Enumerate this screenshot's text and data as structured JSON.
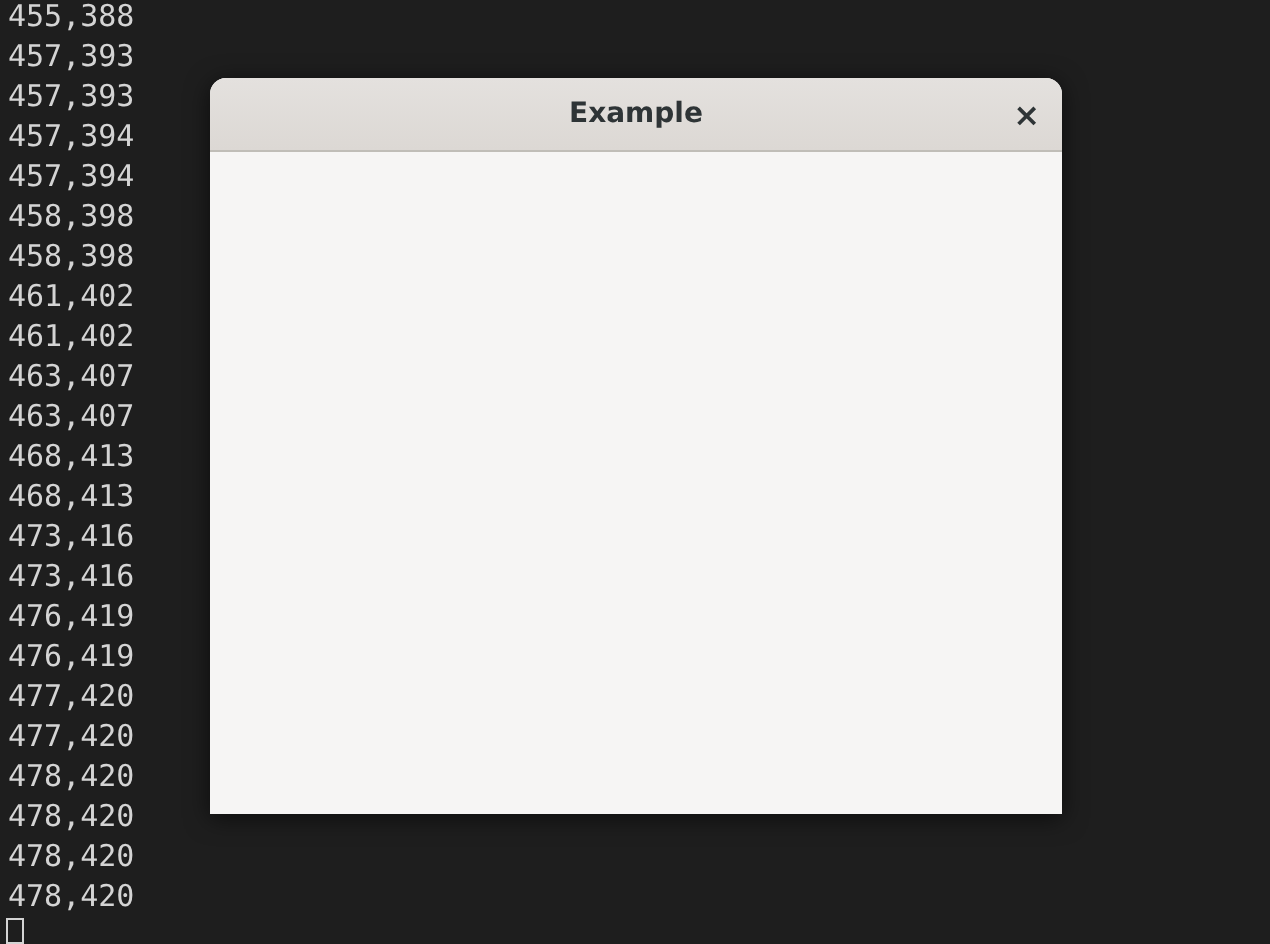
{
  "terminal": {
    "lines": [
      "455,388",
      "457,393",
      "457,393",
      "457,394",
      "457,394",
      "458,398",
      "458,398",
      "461,402",
      "461,402",
      "463,407",
      "463,407",
      "468,413",
      "468,413",
      "473,416",
      "473,416",
      "476,419",
      "476,419",
      "477,420",
      "477,420",
      "478,420",
      "478,420",
      "478,420",
      "478,420"
    ]
  },
  "window": {
    "title": "Example",
    "close": "×"
  }
}
